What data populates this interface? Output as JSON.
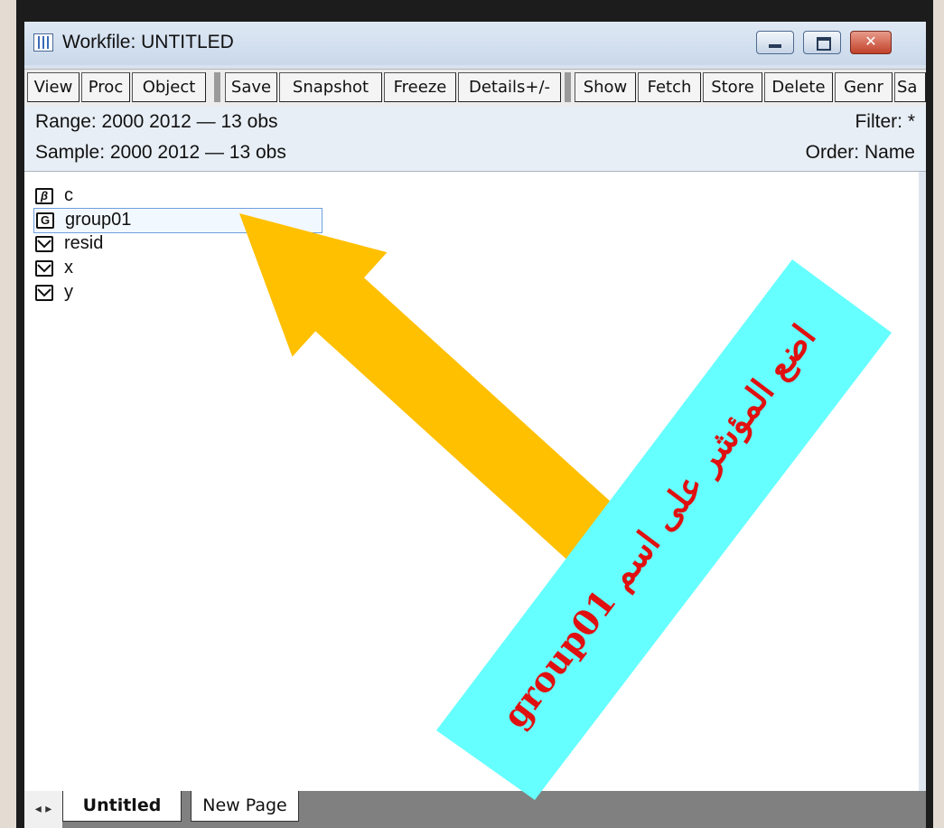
{
  "window": {
    "title": "Workfile: UNTITLED",
    "close_glyph": "✕"
  },
  "toolbar": {
    "buttons": [
      "View",
      "Proc",
      "Object",
      "Save",
      "Snapshot",
      "Freeze",
      "Details+/-",
      "Show",
      "Fetch",
      "Store",
      "Delete",
      "Genr",
      "Sa"
    ]
  },
  "info": {
    "range": "Range:  2000 2012  —  13 obs",
    "sample": "Sample: 2000 2012  —  13 obs",
    "filter": "Filter: *",
    "order": "Order: Name"
  },
  "objects": [
    {
      "name": "c",
      "type_glyph": "β",
      "icon": "coefficient-icon"
    },
    {
      "name": "group01",
      "type_glyph": "G",
      "icon": "group-icon",
      "selected": true
    },
    {
      "name": "resid",
      "type_glyph": "",
      "icon": "series-icon"
    },
    {
      "name": "x",
      "type_glyph": "",
      "icon": "series-icon"
    },
    {
      "name": "y",
      "type_glyph": "",
      "icon": "series-icon"
    }
  ],
  "tabs": {
    "nav_glyph": "◂ ▸",
    "items": [
      "Untitled",
      "New Page"
    ],
    "active": "Untitled"
  },
  "annotation": {
    "text": "اضع المؤشر على اسم group01",
    "box_color": "#66ffff",
    "arrow_color": "#ffc000",
    "text_color": "#e01010"
  }
}
